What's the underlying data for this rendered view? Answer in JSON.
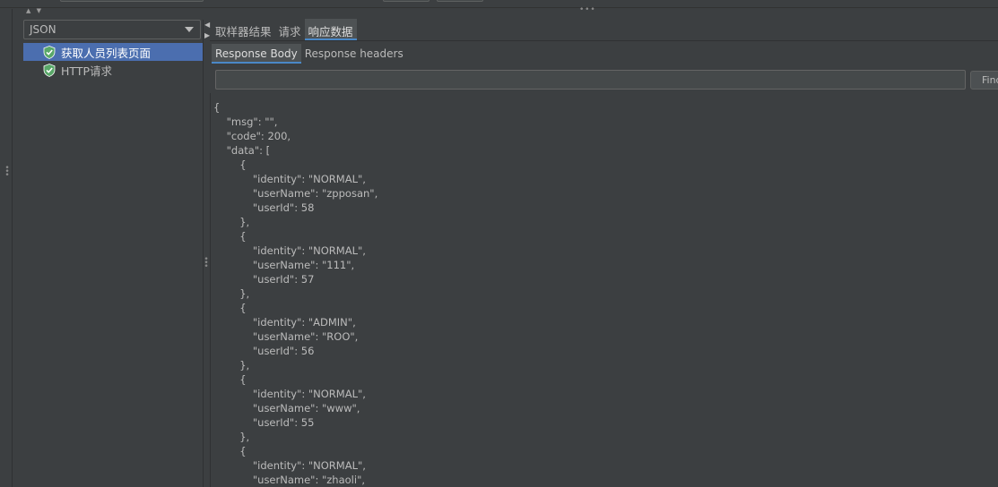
{
  "tree": {
    "renderer": "JSON",
    "items": [
      {
        "label": "获取人员列表页面",
        "status": "success"
      },
      {
        "label": "HTTP请求",
        "status": "success"
      }
    ]
  },
  "tabs": [
    "取样器结果",
    "请求",
    "响应数据"
  ],
  "active_tab": "响应数据",
  "subtabs": [
    "Response Body",
    "Response headers"
  ],
  "active_subtab": "Response Body",
  "search": {
    "value": "",
    "placeholder": ""
  },
  "find_label": "Find",
  "response_lines": [
    "{",
    "    \"msg\": \"\",",
    "    \"code\": 200,",
    "    \"data\": [",
    "        {",
    "            \"identity\": \"NORMAL\",",
    "            \"userName\": \"zpposan\",",
    "            \"userId\": 58",
    "        },",
    "        {",
    "            \"identity\": \"NORMAL\",",
    "            \"userName\": \"111\",",
    "            \"userId\": 57",
    "        },",
    "        {",
    "            \"identity\": \"ADMIN\",",
    "            \"userName\": \"ROO\",",
    "            \"userId\": 56",
    "        },",
    "        {",
    "            \"identity\": \"NORMAL\",",
    "            \"userName\": \"www\",",
    "            \"userId\": 55",
    "        },",
    "        {",
    "            \"identity\": \"NORMAL\",",
    "            \"userName\": \"zhaoli\","
  ],
  "colors": {
    "background": "#3c3f41",
    "selection": "#4b6eaf",
    "success_icon": "#59a869",
    "text": "#bbbbbb"
  },
  "icons": {
    "tree_item": "shield-check-icon",
    "dropdown": "chevron-down-icon"
  }
}
